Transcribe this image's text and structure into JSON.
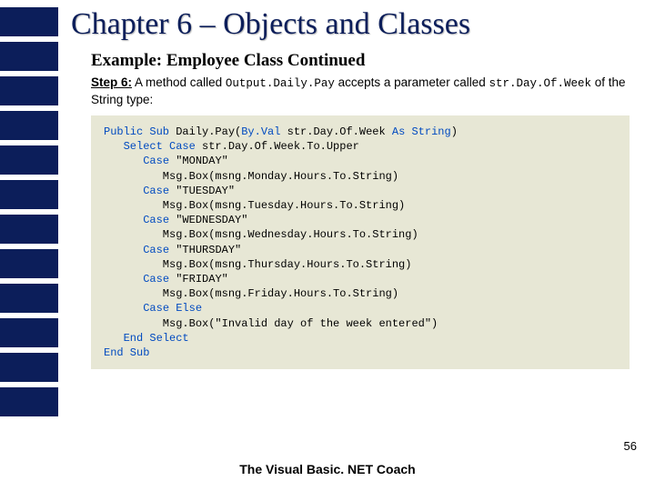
{
  "sidebar": {
    "block_count": 12
  },
  "header": {
    "chapter_title": "Chapter 6 – Objects and Classes",
    "example_title": "Example: Employee Class Continued"
  },
  "step": {
    "label": "Step 6:",
    "text_before": " A method called ",
    "code1": "Output.Daily.Pay",
    "text_mid": " accepts a parameter called ",
    "code2": "str.Day.Of.Week",
    "text_after": " of the String type:"
  },
  "code": {
    "l1a": "Public Sub",
    "l1b": " Daily.Pay(",
    "l1c": "By.Val",
    "l1d": " str.Day.Of.Week ",
    "l1e": "As String",
    "l1f": ")",
    "l2a": "   ",
    "l2b": "Select Case",
    "l2c": " str.Day.Of.Week.To.Upper",
    "l3a": "      ",
    "l3b": "Case",
    "l3c": " \"MONDAY\"",
    "l4": "         Msg.Box(msng.Monday.Hours.To.String)",
    "l5a": "      ",
    "l5b": "Case",
    "l5c": " \"TUESDAY\"",
    "l6": "         Msg.Box(msng.Tuesday.Hours.To.String)",
    "l7a": "      ",
    "l7b": "Case",
    "l7c": " \"WEDNESDAY\"",
    "l8": "         Msg.Box(msng.Wednesday.Hours.To.String)",
    "l9a": "      ",
    "l9b": "Case",
    "l9c": " \"THURSDAY\"",
    "l10": "         Msg.Box(msng.Thursday.Hours.To.String)",
    "l11a": "      ",
    "l11b": "Case",
    "l11c": " \"FRIDAY\"",
    "l12": "         Msg.Box(msng.Friday.Hours.To.String)",
    "l13a": "      ",
    "l13b": "Case Else",
    "l14": "         Msg.Box(\"Invalid day of the week entered\")",
    "l15a": "   ",
    "l15b": "End Select",
    "l16": "End Sub"
  },
  "footer": {
    "page_number": "56",
    "coach": "The Visual Basic. NET Coach"
  }
}
